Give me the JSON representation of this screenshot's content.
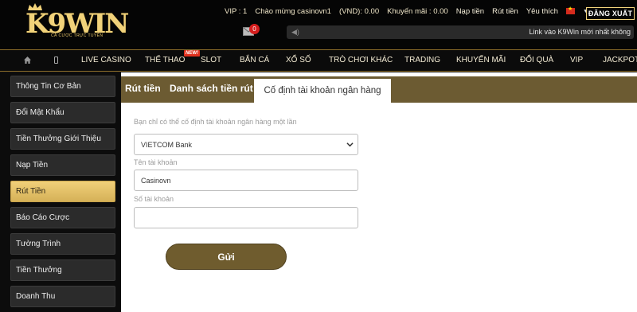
{
  "logo": {
    "text": "K9WIN",
    "tagline": "CÁ CƯỢC TRỰC TUYẾN"
  },
  "topbar": {
    "vip": "VIP : 1",
    "welcome": "Chào mừng casinovn1",
    "balance": "(VND): 0.00",
    "promo": "Khuyến mãi : 0.00",
    "deposit": "Nạp tiền",
    "withdraw": "Rút tiền",
    "favorite": "Yêu thích",
    "language_icon": "vietnam-flag-icon",
    "logout": "ĐĂNG XUẤT"
  },
  "mail": {
    "icon": "envelope-icon",
    "count": "0"
  },
  "marquee": {
    "icon": "speaker-icon",
    "text": "Link vào K9Win mới nhất không"
  },
  "nav": {
    "home_icon": "home-icon",
    "mobile_icon": "phone-icon",
    "items": [
      "LIVE CASINO",
      "THỂ THAO",
      "SLOT",
      "BẮN CÁ",
      "XỔ SỐ",
      "TRÒ CHƠI KHÁC",
      "TRADING",
      "KHUYẾN MÃI",
      "ĐỔI QUÀ",
      "VIP",
      "JACKPOT"
    ],
    "new_badge": "NEW!"
  },
  "sidebar": {
    "items": [
      {
        "label": "Thông Tin Cơ Bản"
      },
      {
        "label": "Đổi Mật Khẩu"
      },
      {
        "label": "Tiền Thưởng Giới Thiệu"
      },
      {
        "label": "Nạp Tiền"
      },
      {
        "label": "Rút Tiền"
      },
      {
        "label": "Báo Cáo Cược"
      },
      {
        "label": "Tường Trình"
      },
      {
        "label": "Tiền Thưởng"
      },
      {
        "label": "Doanh Thu"
      }
    ],
    "active_index": 4
  },
  "tabs": [
    "Rút tiền",
    "Danh sách tiền rút",
    "Cố định tài khoản ngân hàng"
  ],
  "form": {
    "hint": "Bạn chỉ có thể cố định tài khoản ngân hàng một lần",
    "bank_selected": "VIETCOM Bank",
    "account_name_label": "Tên tài khoản",
    "account_name_value": "Casinovn",
    "account_number_label": "Số tài khoản",
    "account_number_value": "",
    "submit": "Gửi"
  },
  "colors": {
    "gold": "#f1d079",
    "brown": "#6c5b32",
    "button_brown": "#6f5c2e",
    "dark_bg": "#0c0c0c"
  }
}
